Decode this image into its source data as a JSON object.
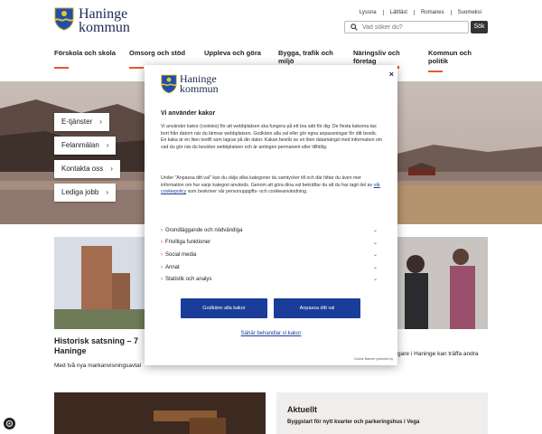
{
  "header": {
    "logo_line1": "Haninge",
    "logo_line2": "kommun",
    "toplinks": [
      "Lyssna",
      "Lättläst",
      "Romanes",
      "Suomeksi"
    ],
    "search_placeholder": "Vad söker du?",
    "search_button": "Sök",
    "nav": [
      "Förskola och skola",
      "Omsorg och stöd",
      "Uppleva och göra",
      "Bygga, trafik och miljö",
      "Näringsliv och företag",
      "Kommun och politik"
    ]
  },
  "hero": {
    "buttons": [
      "E-tjänster",
      "Felanmälan",
      "Kontakta oss",
      "Lediga jobb"
    ]
  },
  "cards": {
    "left_title_line1": "Historisk satsning – 7",
    "left_title_line2": "Haninge",
    "left_text": "Med två nya markanvisningsavtal",
    "right_text": "gare i Haninge kan träffa andra"
  },
  "aktuellt": {
    "title": "Aktuellt",
    "item": "Byggstart för nytt kvarter och parkeringshus i Vega"
  },
  "cookie_modal": {
    "logo_line1": "Haninge",
    "logo_line2": "kommun",
    "close": "×",
    "heading": "Vi använder kakor",
    "paragraph1": "Vi använder kakor (cookies) för att webbplatsen ska fungera på ett bra sätt för dig. De flesta kakorna tas bort från datorn när du lämnar webbplatsen. Godkänn alla val eller gör egna anpassningar för ditt besök. En kaka är en liten textfil som lagras på din dator. Kakan består av en liten datamängd med information om vad du gör när du besöker webbplatsen och är antingen permanent eller tillfällig.",
    "paragraph2_before": "Under \"Anpassa ditt val\" kan du välja vilka kategorier du samtycker till och där hittar du även mer information om hur varje kategori används. Genom att göra dina val bekräftar du att du har tagit del av ",
    "paragraph2_link": "vår cookiepolicy",
    "paragraph2_after": " som beskriver vår personuppgifts- och cookieanvändning.",
    "categories": [
      "Grundläggande och nödvändiga",
      "Frivilliga funktioner",
      "Social media",
      "Annat",
      "Statistik och analys"
    ],
    "accept_all": "Godkänn alla kakor",
    "customize": "Anpassa ditt val",
    "manage_link": "Sähär behandlar vi kakor",
    "powered_by": "Cookie Banner powered by"
  },
  "colors": {
    "accent": "#e8572f",
    "primary": "#1a3d99",
    "brand_text": "#1d2a52"
  }
}
